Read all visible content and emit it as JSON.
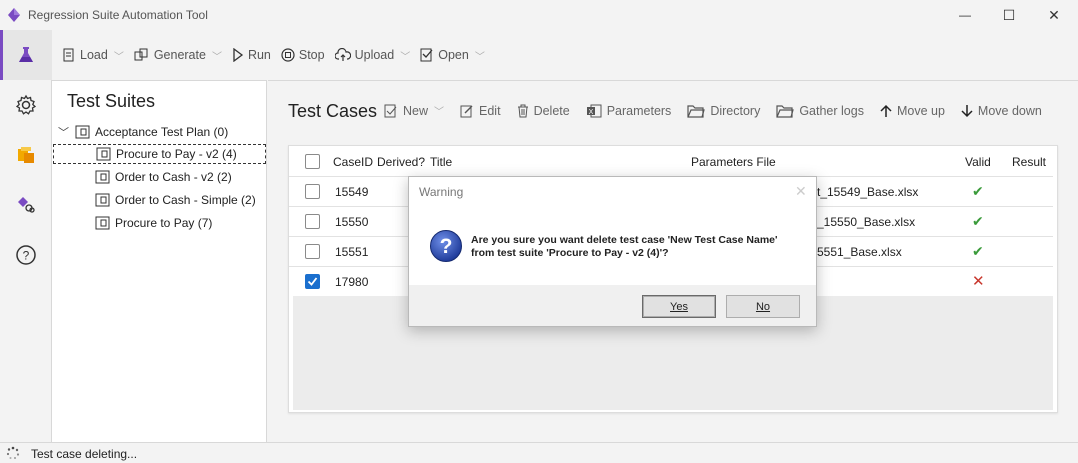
{
  "window": {
    "title": "Regression Suite Automation Tool",
    "minimize": "—",
    "maximize": "☐",
    "close": "✕"
  },
  "toolbar": {
    "load": "Load",
    "generate": "Generate",
    "run": "Run",
    "stop": "Stop",
    "upload": "Upload",
    "open": "Open"
  },
  "suites": {
    "title": "Test Suites",
    "items": [
      {
        "label": "Acceptance Test Plan (0)"
      },
      {
        "label": "Procure to Pay - v2 (4)"
      },
      {
        "label": "Order to Cash - v2 (2)"
      },
      {
        "label": "Order to Cash - Simple (2)"
      },
      {
        "label": "Procure to Pay (7)"
      }
    ]
  },
  "cases": {
    "title": "Test Cases",
    "toolbar": {
      "new": "New",
      "edit": "Edit",
      "delete": "Delete",
      "parameters": "Parameters",
      "directory": "Directory",
      "gather_logs": "Gather logs",
      "move_up": "Move up",
      "move_down": "Move down"
    },
    "columns": {
      "caseid": "CaseID",
      "derived": "Derived?",
      "title": "Title",
      "params": "Parameters File",
      "valid": "Valid",
      "result": "Result"
    },
    "rows": [
      {
        "caseid": "15549",
        "params": "t_15549_Base.xlsx",
        "valid": "✔",
        "checked": false
      },
      {
        "caseid": "15550",
        "params": "_15550_Base.xlsx",
        "valid": "✔",
        "checked": false
      },
      {
        "caseid": "15551",
        "params": "5551_Base.xlsx",
        "valid": "✔",
        "checked": false
      },
      {
        "caseid": "17980",
        "params": "",
        "valid": "✕",
        "checked": true
      }
    ]
  },
  "status": {
    "text": "Test case deleting..."
  },
  "dialog": {
    "title": "Warning",
    "close": "✕",
    "message_line1": "Are you sure you want delete test case 'New Test Case Name'",
    "message_line2": "from test suite 'Procure to Pay - v2 (4)'?",
    "yes": "Yes",
    "no": "No"
  },
  "colors": {
    "accent": "#7a4bc2",
    "valid": "#3a9b3a",
    "invalid": "#c8372d",
    "checkbox": "#1a6fce"
  }
}
